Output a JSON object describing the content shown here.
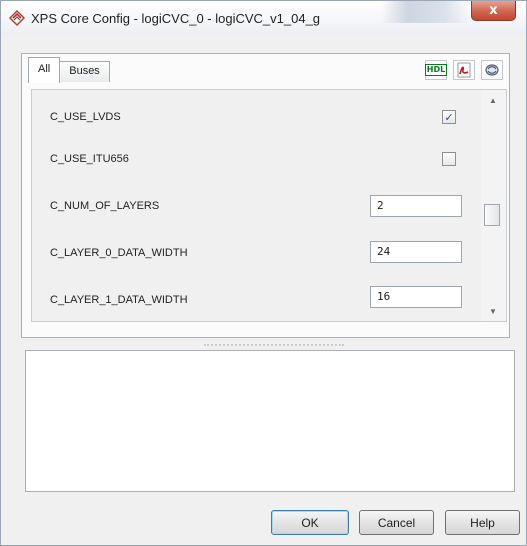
{
  "window": {
    "title": "XPS Core Config - logiCVC_0 - logiCVC_v1_04_g",
    "close_label": "x"
  },
  "tabs": [
    {
      "label": "All"
    },
    {
      "label": "Buses"
    }
  ],
  "toolbar": {
    "hdl_label": "HDL",
    "icons": [
      "hdl-icon",
      "pdf-icon",
      "refresh-icon"
    ]
  },
  "parameters": [
    {
      "name": "C_USE_LVDS",
      "type": "checkbox",
      "checked": true
    },
    {
      "name": "C_USE_ITU656",
      "type": "checkbox",
      "checked": false
    },
    {
      "name": "C_NUM_OF_LAYERS",
      "type": "text",
      "value": "2"
    },
    {
      "name": "C_LAYER_0_DATA_WIDTH",
      "type": "text",
      "value": "24"
    },
    {
      "name": "C_LAYER_1_DATA_WIDTH",
      "type": "text",
      "value": "16"
    }
  ],
  "scrollbar": {
    "up": "▲",
    "down": "▼"
  },
  "buttons": {
    "ok": "OK",
    "cancel": "Cancel",
    "help": "Help"
  },
  "colors": {
    "close_button": "#c2462b",
    "window_bg": "#f0f0f0",
    "hdl_green": "#0b7a1f"
  }
}
